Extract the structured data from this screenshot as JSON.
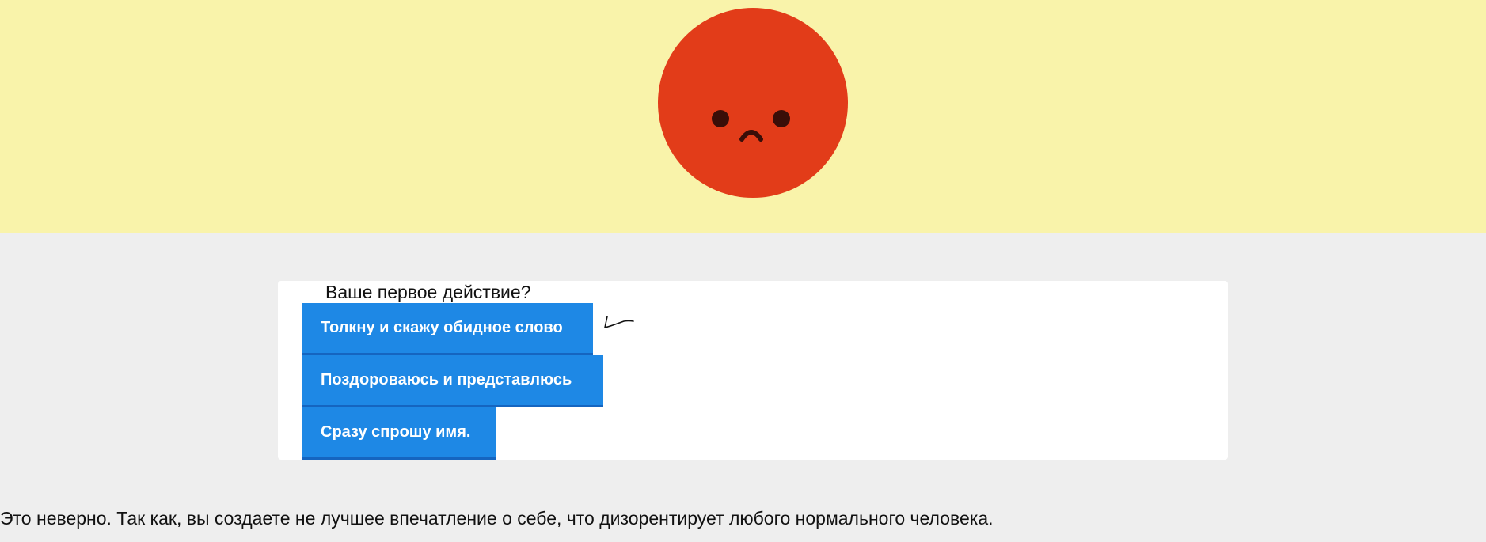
{
  "hero": {
    "background": "#f9f3aa",
    "mood_icon": "sad-face-icon",
    "face_color": "#e23c19",
    "feature_color": "#3a0e08"
  },
  "quiz": {
    "question": "Ваше первое действие?",
    "options": [
      "Толкну и скажу обидное слово",
      "Поздороваюсь и представлюсь",
      "Сразу спрошу имя."
    ],
    "button_color": "#1e88e5"
  },
  "feedback": {
    "text": "Это неверно. Так как, вы создаете не лучшее впечатление о себе, что дизорентирует любого нормального человека."
  }
}
